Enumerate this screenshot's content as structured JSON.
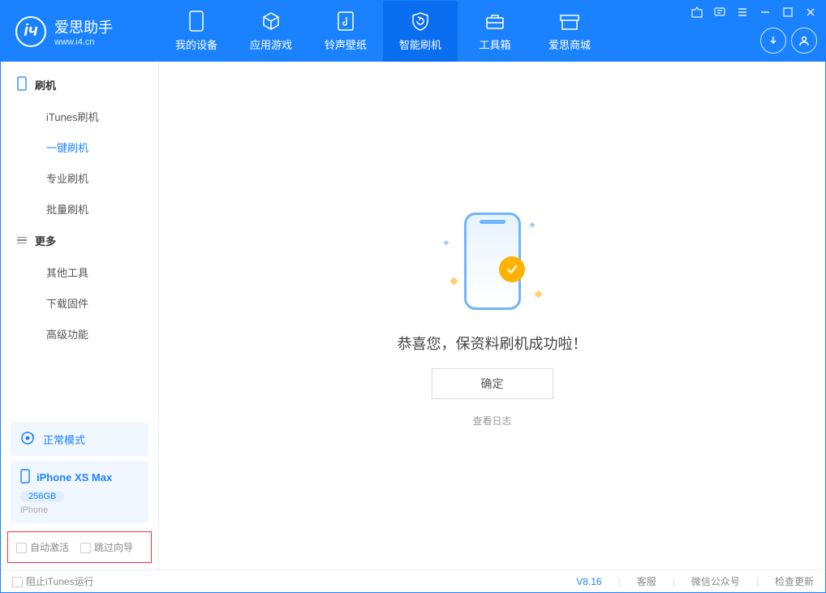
{
  "app": {
    "name": "爱思助手",
    "url": "www.i4.cn"
  },
  "tabs": [
    {
      "label": "我的设备"
    },
    {
      "label": "应用游戏"
    },
    {
      "label": "铃声壁纸"
    },
    {
      "label": "智能刷机"
    },
    {
      "label": "工具箱"
    },
    {
      "label": "爱思商城"
    }
  ],
  "sidebar": {
    "group1": {
      "title": "刷机",
      "items": [
        {
          "label": "iTunes刷机"
        },
        {
          "label": "一键刷机"
        },
        {
          "label": "专业刷机"
        },
        {
          "label": "批量刷机"
        }
      ]
    },
    "group2": {
      "title": "更多",
      "items": [
        {
          "label": "其他工具"
        },
        {
          "label": "下载固件"
        },
        {
          "label": "高级功能"
        }
      ]
    },
    "mode": "正常模式",
    "device": {
      "name": "iPhone XS Max",
      "capacity": "256GB",
      "type": "iPhone"
    },
    "options": {
      "auto_activate": "自动激活",
      "skip_guide": "跳过向导"
    }
  },
  "content": {
    "message": "恭喜您，保资料刷机成功啦！",
    "ok": "确定",
    "view_log": "查看日志"
  },
  "status": {
    "block_itunes": "阻止iTunes运行",
    "version": "V8.16",
    "links": [
      "客服",
      "微信公众号",
      "检查更新"
    ]
  }
}
